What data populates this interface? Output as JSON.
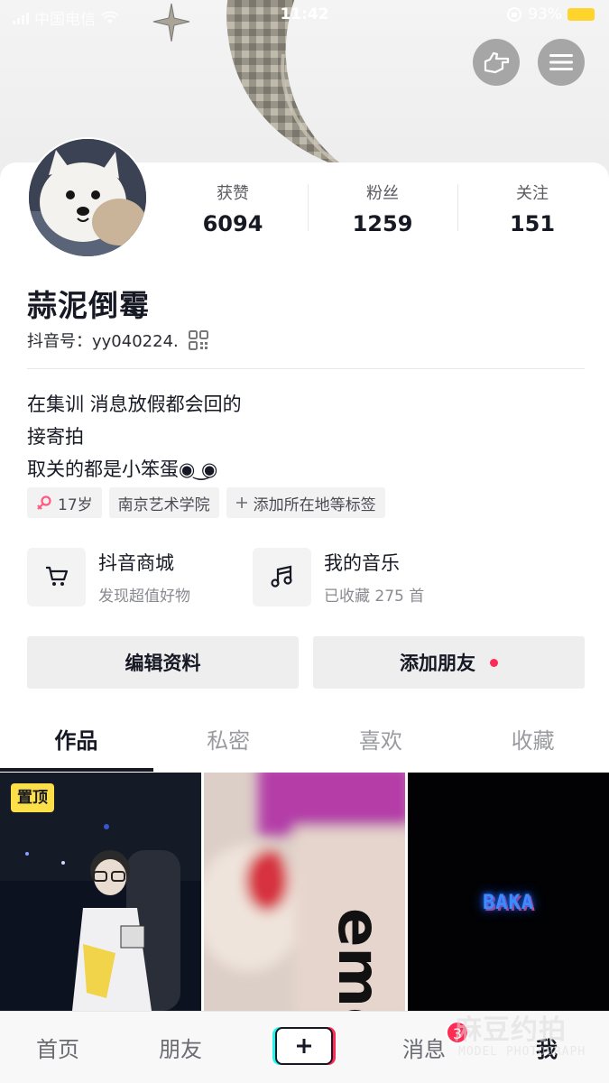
{
  "status_bar": {
    "carrier": "中国电信",
    "time": "11:42",
    "battery": "93%"
  },
  "profile": {
    "nickname": "蒜泥倒霉",
    "douyin_id": "抖音号：yy040224.",
    "stats": [
      {
        "label": "获赞",
        "value": "6094"
      },
      {
        "label": "粉丝",
        "value": "1259"
      },
      {
        "label": "关注",
        "value": "151"
      }
    ],
    "bio": [
      "在集训 消息放假都会回的",
      "接寄拍",
      "取关的都是小笨蛋◉ ͜◉"
    ],
    "tags": [
      {
        "label": "17岁",
        "icon": "female-icon"
      },
      {
        "label": "南京艺术学院"
      },
      {
        "label": "添加所在地等标签",
        "icon": "plus-icon"
      }
    ]
  },
  "services": [
    {
      "title": "抖音商城",
      "subtitle": "发现超值好物",
      "icon": "cart-icon"
    },
    {
      "title": "我的音乐",
      "subtitle": "已收藏 275 首",
      "icon": "music-note-icon"
    }
  ],
  "actions": {
    "edit_profile": "编辑资料",
    "add_friends": "添加朋友"
  },
  "content_tabs": [
    "作品",
    "私密",
    "喜欢",
    "收藏"
  ],
  "active_tab": "作品",
  "videos": [
    {
      "badge": "置顶",
      "caption": "",
      "theme": "night-portrait"
    },
    {
      "caption": "",
      "theme": "blurred-emo"
    },
    {
      "caption": "BAKA",
      "theme": "neon-text"
    }
  ],
  "bottom_nav": {
    "home": "首页",
    "friends": "朋友",
    "messages": "消息",
    "messages_badge": "3",
    "me": "我"
  },
  "watermark": {
    "main": "麻豆约拍",
    "sub": "MODEL PHOTOGRAPH"
  },
  "colors": {
    "accent_red": "#fe2c55",
    "accent_cyan": "#25f4ee",
    "pin_yellow": "#fde047",
    "battery_yellow": "#ffd42b"
  }
}
